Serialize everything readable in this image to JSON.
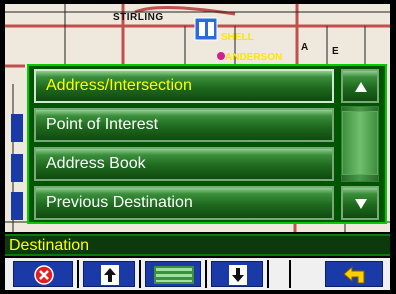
{
  "map": {
    "street_top": "STIRLING",
    "poi_shell": "SHELL",
    "poi_anderson": "ANDERSON",
    "street_a": "A",
    "street_e": "E"
  },
  "menu": {
    "items": [
      {
        "label": "Address/Intersection",
        "selected": true
      },
      {
        "label": "Point of Interest",
        "selected": false
      },
      {
        "label": "Address Book",
        "selected": false
      },
      {
        "label": "Previous Destination",
        "selected": false
      }
    ],
    "scroll_up_icon": "triangle-up-icon",
    "scroll_down_icon": "triangle-down-icon"
  },
  "status": {
    "title": "Destination"
  },
  "toolbar": {
    "cancel_icon": "cancel-x-icon",
    "page_up_icon": "page-up-arrow-icon",
    "list_icon": "list-lines-icon",
    "page_down_icon": "page-down-arrow-icon",
    "back_icon": "back-arrow-icon"
  },
  "colors": {
    "menu_selected_text": "#ffff00",
    "menu_text": "#ffffff",
    "status_text": "#ffff00",
    "toolbar_button": "#1a3aa8"
  }
}
